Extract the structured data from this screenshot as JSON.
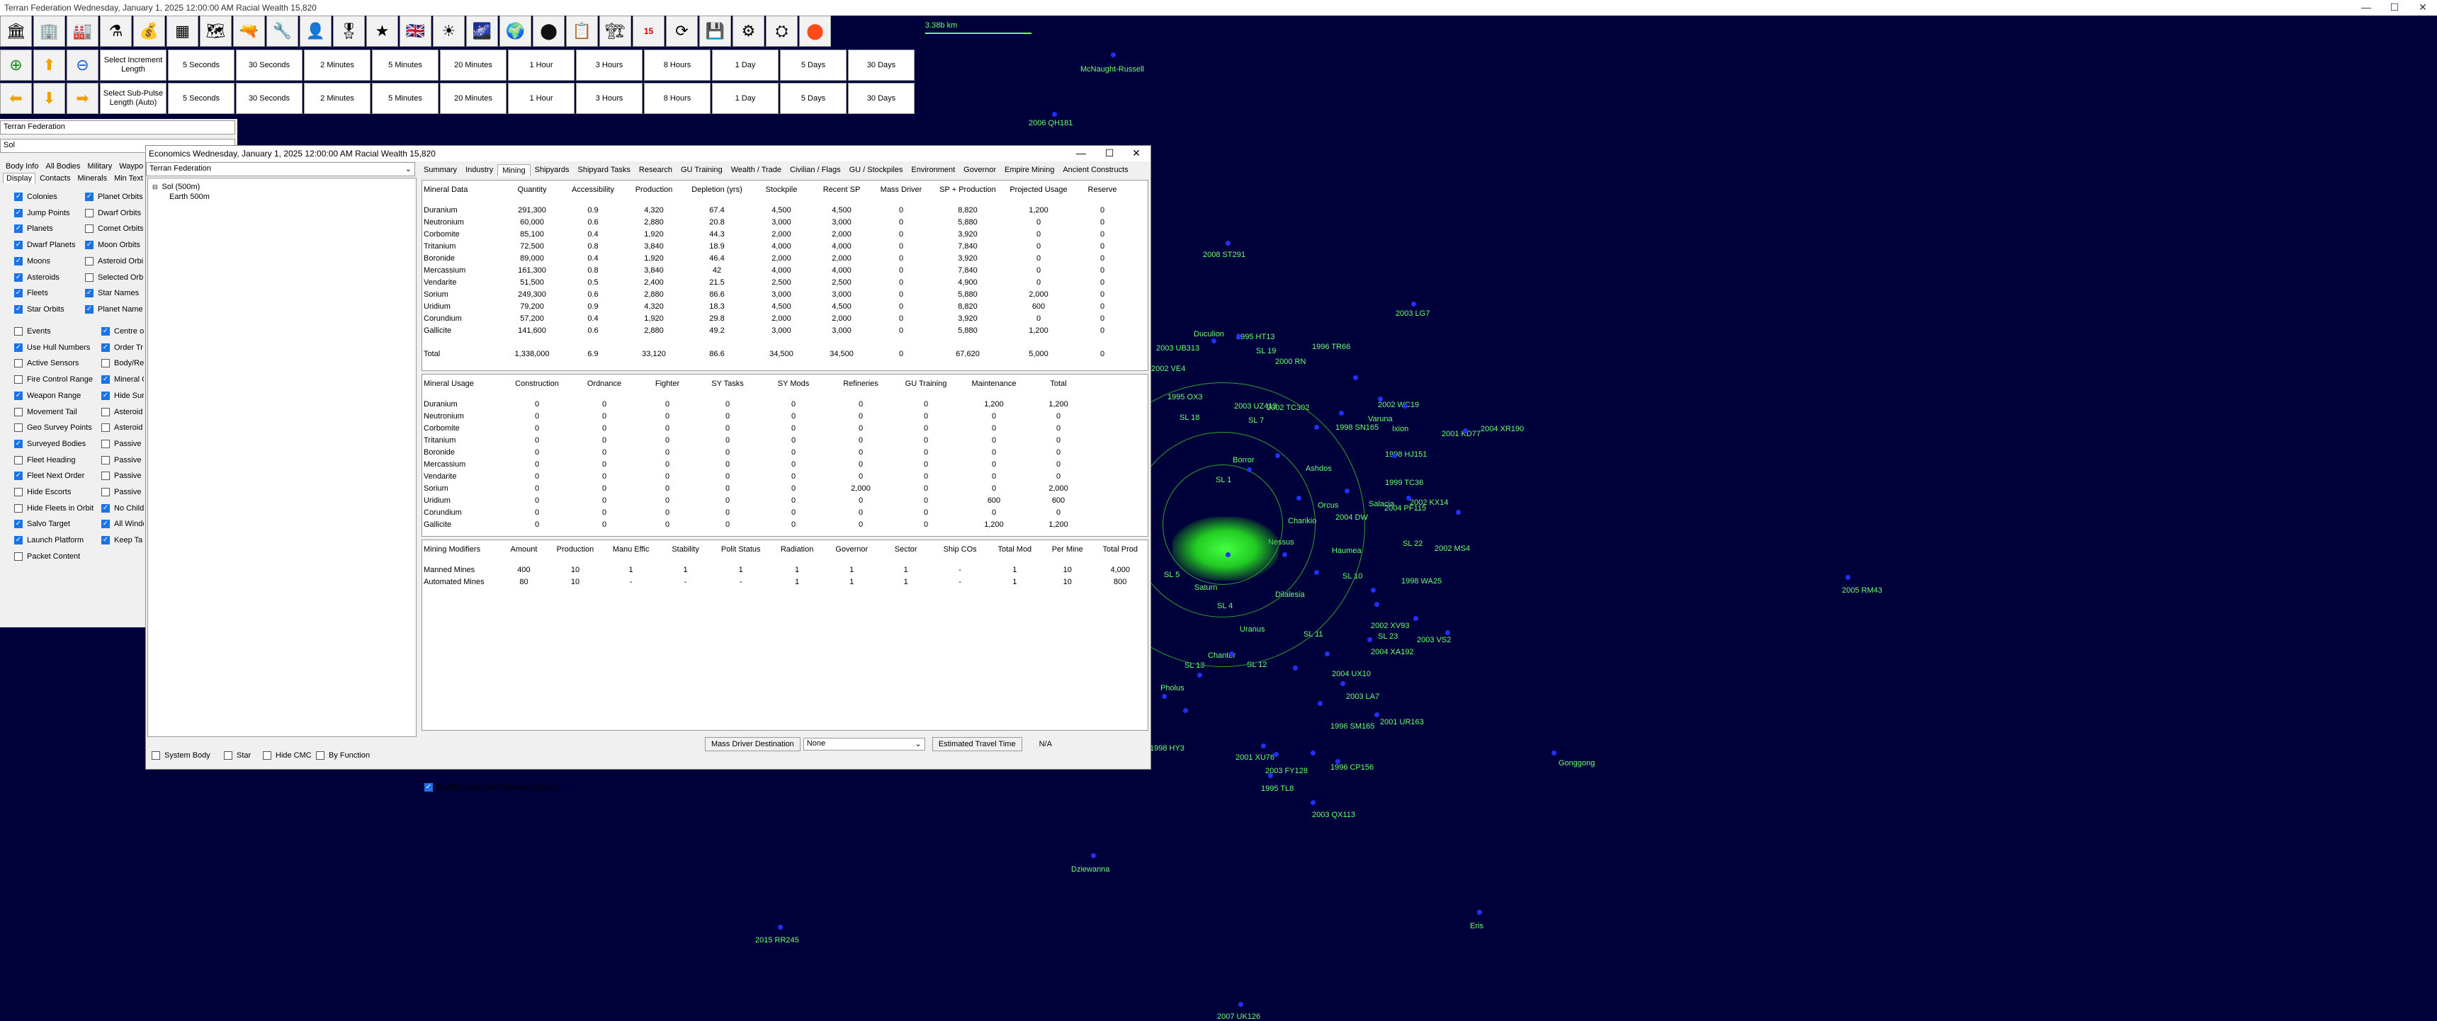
{
  "window": {
    "title": "Terran Federation   Wednesday, January 1, 2025 12:00:00 AM   Racial Wealth 15,820",
    "controls": [
      "—",
      "☐",
      "✕"
    ]
  },
  "toolbar": {
    "icons": [
      "building-icon",
      "ship-icon",
      "factory-icon",
      "flask-icon",
      "money-icon",
      "grid-icon",
      "map-icon",
      "pistol-icon",
      "rifle-icon",
      "soldier-icon",
      "officer-icon",
      "star-icon",
      "flag-icon",
      "system-icon",
      "galaxy-icon",
      "globe-icon",
      "dot-icon",
      "card-icon",
      "factory2-icon",
      "calendar-icon",
      "refresh-icon",
      "save-icon",
      "gear-icon",
      "faction-icon",
      "sphere-icon"
    ],
    "glyphs": [
      "🏛",
      "🏢",
      "🏭",
      "⚗",
      "💰",
      "▦",
      "🗺",
      "🔫",
      "🔧",
      "👤",
      "🎖",
      "★",
      "🇬🇧",
      "☀",
      "🌌",
      "🌍",
      "⬤",
      "📋",
      "🏗",
      "📅",
      "⟳",
      "💾",
      "⚙",
      "⛭",
      "⬤"
    ],
    "calendar_day": "15"
  },
  "increment": {
    "label": "Select Increment Length",
    "buttons": [
      "5 Seconds",
      "30 Seconds",
      "2 Minutes",
      "5 Minutes",
      "20 Minutes",
      "1 Hour",
      "3 Hours",
      "8 Hours",
      "1 Day",
      "5 Days",
      "30 Days"
    ]
  },
  "subpulse": {
    "label": "Select Sub-Pulse Length (Auto)",
    "buttons": [
      "5 Seconds",
      "30 Seconds",
      "2 Minutes",
      "5 Minutes",
      "20 Minutes",
      "1 Hour",
      "3 Hours",
      "8 Hours",
      "1 Day",
      "5 Days",
      "30 Days"
    ]
  },
  "scale_label": "3.38b km",
  "left": {
    "race": "Terran Federation",
    "system": "Sol",
    "tabs_row1": [
      "Body Info",
      "All Bodies",
      "Military",
      "Waypo"
    ],
    "tabs_row2": [
      "Display",
      "Contacts",
      "Minerals",
      "Min Text"
    ],
    "col1": [
      {
        "label": "Colonies",
        "on": true
      },
      {
        "label": "Jump Points",
        "on": true
      },
      {
        "label": "Planets",
        "on": true
      },
      {
        "label": "Dwarf Planets",
        "on": true
      },
      {
        "label": "Moons",
        "on": true
      },
      {
        "label": "Asteroids",
        "on": true
      },
      {
        "label": "Fleets",
        "on": true
      },
      {
        "label": "Star Orbits",
        "on": true
      }
    ],
    "col2": [
      {
        "label": "Planet Orbits",
        "on": true
      },
      {
        "label": "Dwarf Orbits",
        "on": false
      },
      {
        "label": "Comet Orbits",
        "on": false
      },
      {
        "label": "Moon Orbits",
        "on": true
      },
      {
        "label": "Asteroid Orbit",
        "on": false
      },
      {
        "label": "Selected Orbi",
        "on": false
      },
      {
        "label": "Star Names",
        "on": true
      },
      {
        "label": "Planet Names",
        "on": true
      }
    ],
    "col3": [
      {
        "label": "Events",
        "on": false
      },
      {
        "label": "Use Hull Numbers",
        "on": true
      },
      {
        "label": "Active Sensors",
        "on": false
      },
      {
        "label": "Fire Control Range",
        "on": false
      },
      {
        "label": "Weapon Range",
        "on": true
      },
      {
        "label": "Movement Tail",
        "on": false
      },
      {
        "label": "Geo Survey Points",
        "on": false
      },
      {
        "label": "Surveyed Bodies",
        "on": true
      },
      {
        "label": "Fleet Heading",
        "on": false
      },
      {
        "label": "Fleet Next Order",
        "on": true
      },
      {
        "label": "Hide Escorts",
        "on": false
      },
      {
        "label": "Hide Fleets in Orbit",
        "on": false
      },
      {
        "label": "Salvo Target",
        "on": true
      },
      {
        "label": "Launch Platform",
        "on": true
      },
      {
        "label": "Packet Content",
        "on": false
      }
    ],
    "col4": [
      {
        "label": "Centre o",
        "on": true
      },
      {
        "label": "Order Tr",
        "on": true
      },
      {
        "label": "Body/Re",
        "on": false
      },
      {
        "label": "Mineral C",
        "on": true
      },
      {
        "label": "Hide Sur",
        "on": true
      },
      {
        "label": "Asteroid",
        "on": false
      },
      {
        "label": "Asteroid",
        "on": false
      },
      {
        "label": "Passive",
        "on": false
      },
      {
        "label": "Passive",
        "on": false
      },
      {
        "label": "Passive",
        "on": false
      },
      {
        "label": "Passive",
        "on": false
      },
      {
        "label": "No Child",
        "on": true
      },
      {
        "label": "All Windo",
        "on": true
      },
      {
        "label": "Keep Ta",
        "on": true
      }
    ]
  },
  "econ": {
    "title": "Economics   Wednesday, January 1, 2025 12:00:00 AM   Racial Wealth 15,820",
    "race": "Terran Federation",
    "tabs": [
      "Summary",
      "Industry",
      "Mining",
      "Shipyards",
      "Shipyard Tasks",
      "Research",
      "GU Training",
      "Wealth / Trade",
      "Civilian / Flags",
      "GU / Stockpiles",
      "Environment",
      "Governor",
      "Empire Mining",
      "Ancient Constructs"
    ],
    "active_tab": "Mining",
    "tree": [
      "Sol  (500m)",
      "Earth  500m"
    ],
    "bottom_checks": [
      {
        "label": "System Body",
        "on": false
      },
      {
        "label": "Star",
        "on": false
      },
      {
        "label": "Hide CMC",
        "on": false
      },
      {
        "label": "By Function",
        "on": false
      }
    ],
    "dblclick": {
      "label": "Double-click Sets Reserve Amount",
      "on": true
    },
    "mineral_data": {
      "headers": [
        "Mineral Data",
        "Quantity",
        "Accessibility",
        "Production",
        "Depletion (yrs)",
        "Stockpile",
        "Recent SP",
        "Mass Driver",
        "SP + Production",
        "Projected Usage",
        "Reserve"
      ],
      "rows": [
        [
          "Duranium",
          "291,300",
          "0.9",
          "4,320",
          "67.4",
          "4,500",
          "4,500",
          "0",
          "8,820",
          "1,200",
          "0"
        ],
        [
          "Neutronium",
          "60,000",
          "0.6",
          "2,880",
          "20.8",
          "3,000",
          "3,000",
          "0",
          "5,880",
          "0",
          "0"
        ],
        [
          "Corbomite",
          "85,100",
          "0.4",
          "1,920",
          "44.3",
          "2,000",
          "2,000",
          "0",
          "3,920",
          "0",
          "0"
        ],
        [
          "Tritanium",
          "72,500",
          "0.8",
          "3,840",
          "18.9",
          "4,000",
          "4,000",
          "0",
          "7,840",
          "0",
          "0"
        ],
        [
          "Boronide",
          "89,000",
          "0.4",
          "1,920",
          "46.4",
          "2,000",
          "2,000",
          "0",
          "3,920",
          "0",
          "0"
        ],
        [
          "Mercassium",
          "161,300",
          "0.8",
          "3,840",
          "42",
          "4,000",
          "4,000",
          "0",
          "7,840",
          "0",
          "0"
        ],
        [
          "Vendarite",
          "51,500",
          "0.5",
          "2,400",
          "21.5",
          "2,500",
          "2,500",
          "0",
          "4,900",
          "0",
          "0"
        ],
        [
          "Sorium",
          "249,300",
          "0.6",
          "2,880",
          "86.6",
          "3,000",
          "3,000",
          "0",
          "5,880",
          "2,000",
          "0"
        ],
        [
          "Uridium",
          "79,200",
          "0.9",
          "4,320",
          "18.3",
          "4,500",
          "4,500",
          "0",
          "8,820",
          "600",
          "0"
        ],
        [
          "Corundium",
          "57,200",
          "0.4",
          "1,920",
          "29.8",
          "2,000",
          "2,000",
          "0",
          "3,920",
          "0",
          "0"
        ],
        [
          "Gallicite",
          "141,600",
          "0.6",
          "2,880",
          "49.2",
          "3,000",
          "3,000",
          "0",
          "5,880",
          "1,200",
          "0"
        ]
      ],
      "total": [
        "Total",
        "1,338,000",
        "6.9",
        "33,120",
        "86.6",
        "34,500",
        "34,500",
        "0",
        "67,620",
        "5,000",
        "0"
      ]
    },
    "mineral_usage": {
      "headers": [
        "Mineral Usage",
        "Construction",
        "Ordnance",
        "Fighter",
        "SY Tasks",
        "SY Mods",
        "Refineries",
        "GU Training",
        "Maintenance",
        "Total"
      ],
      "rows": [
        [
          "Duranium",
          "0",
          "0",
          "0",
          "0",
          "0",
          "0",
          "0",
          "1,200",
          "1,200"
        ],
        [
          "Neutronium",
          "0",
          "0",
          "0",
          "0",
          "0",
          "0",
          "0",
          "0",
          "0"
        ],
        [
          "Corbomite",
          "0",
          "0",
          "0",
          "0",
          "0",
          "0",
          "0",
          "0",
          "0"
        ],
        [
          "Tritanium",
          "0",
          "0",
          "0",
          "0",
          "0",
          "0",
          "0",
          "0",
          "0"
        ],
        [
          "Boronide",
          "0",
          "0",
          "0",
          "0",
          "0",
          "0",
          "0",
          "0",
          "0"
        ],
        [
          "Mercassium",
          "0",
          "0",
          "0",
          "0",
          "0",
          "0",
          "0",
          "0",
          "0"
        ],
        [
          "Vendarite",
          "0",
          "0",
          "0",
          "0",
          "0",
          "0",
          "0",
          "0",
          "0"
        ],
        [
          "Sorium",
          "0",
          "0",
          "0",
          "0",
          "0",
          "2,000",
          "0",
          "0",
          "2,000"
        ],
        [
          "Uridium",
          "0",
          "0",
          "0",
          "0",
          "0",
          "0",
          "0",
          "600",
          "600"
        ],
        [
          "Corundium",
          "0",
          "0",
          "0",
          "0",
          "0",
          "0",
          "0",
          "0",
          "0"
        ],
        [
          "Gallicite",
          "0",
          "0",
          "0",
          "0",
          "0",
          "0",
          "0",
          "1,200",
          "1,200"
        ]
      ]
    },
    "mining_modifiers": {
      "headers": [
        "Mining Modifiers",
        "Amount",
        "Production",
        "Manu Effic",
        "Stability",
        "Polit Status",
        "Radiation",
        "Governor",
        "Sector",
        "Ship COs",
        "Total Mod",
        "Per Mine",
        "Total Prod"
      ],
      "rows": [
        [
          "Manned Mines",
          "400",
          "10",
          "1",
          "1",
          "1",
          "1",
          "1",
          "1",
          "-",
          "1",
          "10",
          "4,000"
        ],
        [
          "Automated Mines",
          "80",
          "10",
          "-",
          "-",
          "-",
          "1",
          "1",
          "1",
          "-",
          "1",
          "10",
          "800"
        ]
      ]
    },
    "mass_driver_label": "Mass Driver Destination",
    "mass_driver_value": "None",
    "travel_label": "Estimated Travel Time",
    "travel_value": "N/A"
  },
  "map_labels": [
    "McNaught-Russell",
    "2006 QH181",
    "2008 ST291",
    "2003 LG7",
    "Duculion",
    "1995 HT13",
    "1996 TR66",
    "2003 UB313",
    "SL 19",
    "2000 RN",
    "2004 XR190",
    "2002 VE4",
    "1995 OX3",
    "2003 UZ413",
    "SL 18",
    "SL 7",
    "2002 TC302",
    "2002 WC19",
    "2001 KD77",
    "1998 SN165",
    "Varuna",
    "Ixion",
    "1998 HJ151",
    "2004 PF115",
    "Borror",
    "Ashdos",
    "SL 1",
    "Gonggong",
    "1999 TC36",
    "Salacia",
    "Orcus",
    "2002 KX14",
    "Charikio",
    "2004 DW",
    "Nessus",
    "2002 MS4",
    "Haumea",
    "1998 WA25",
    "SL 10",
    "SL 22",
    "SL 5",
    "Saturn",
    "SL 4",
    "Dilalesia",
    "Uranus",
    "SL 11",
    "2005 RM43",
    "2002 XV93",
    "2003 VS2",
    "SL 23",
    "2004 XA192",
    "Chanter",
    "SL 13",
    "Pholus",
    "SL 12",
    "2004 UX10",
    "2003 LA7",
    "1996 SM165",
    "2001 UR163",
    "1998 HY3",
    "2001 XU76",
    "2003 FY128",
    "1996 CP156",
    "1995 TL8",
    "2003 QX113",
    "Dziewanna",
    "2015 RR245",
    "Eris",
    "2007 UK126"
  ]
}
